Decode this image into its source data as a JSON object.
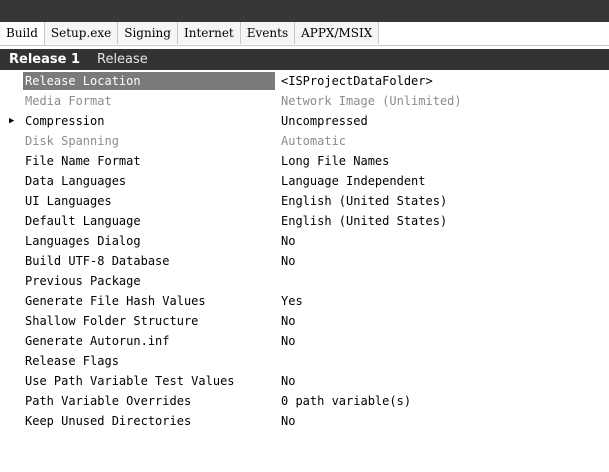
{
  "tabs": [
    {
      "label": "Build",
      "active": true
    },
    {
      "label": "Setup.exe",
      "active": false
    },
    {
      "label": "Signing",
      "active": false
    },
    {
      "label": "Internet",
      "active": false
    },
    {
      "label": "Events",
      "active": false
    },
    {
      "label": "APPX/MSIX",
      "active": false
    }
  ],
  "release": {
    "name": "Release 1",
    "type": "Release"
  },
  "properties": [
    {
      "name": "Release Location",
      "value": "<ISProjectDataFolder>",
      "selected": true,
      "disabled": false,
      "expandable": false
    },
    {
      "name": "Media Format",
      "value": "Network Image (Unlimited)",
      "selected": false,
      "disabled": true,
      "expandable": false
    },
    {
      "name": "Compression",
      "value": "Uncompressed",
      "selected": false,
      "disabled": false,
      "expandable": true
    },
    {
      "name": "Disk Spanning",
      "value": "Automatic",
      "selected": false,
      "disabled": true,
      "expandable": false
    },
    {
      "name": "File Name Format",
      "value": "Long File Names",
      "selected": false,
      "disabled": false,
      "expandable": false
    },
    {
      "name": "Data Languages",
      "value": "Language Independent",
      "selected": false,
      "disabled": false,
      "expandable": false
    },
    {
      "name": "UI Languages",
      "value": "English (United States)",
      "selected": false,
      "disabled": false,
      "expandable": false
    },
    {
      "name": "Default Language",
      "value": "English (United States)",
      "selected": false,
      "disabled": false,
      "expandable": false
    },
    {
      "name": "Languages Dialog",
      "value": "No",
      "selected": false,
      "disabled": false,
      "expandable": false
    },
    {
      "name": "Build UTF-8 Database",
      "value": "No",
      "selected": false,
      "disabled": false,
      "expandable": false
    },
    {
      "name": "Previous Package",
      "value": "",
      "selected": false,
      "disabled": false,
      "expandable": false
    },
    {
      "name": "Generate File Hash Values",
      "value": "Yes",
      "selected": false,
      "disabled": false,
      "expandable": false
    },
    {
      "name": "Shallow Folder Structure",
      "value": "No",
      "selected": false,
      "disabled": false,
      "expandable": false
    },
    {
      "name": "Generate Autorun.inf",
      "value": "No",
      "selected": false,
      "disabled": false,
      "expandable": false
    },
    {
      "name": "Release Flags",
      "value": "",
      "selected": false,
      "disabled": false,
      "expandable": false
    },
    {
      "name": "Use Path Variable Test Values",
      "value": "No",
      "selected": false,
      "disabled": false,
      "expandable": false
    },
    {
      "name": "Path Variable Overrides",
      "value": "0 path variable(s)",
      "selected": false,
      "disabled": false,
      "expandable": false
    },
    {
      "name": "Keep Unused Directories",
      "value": "No",
      "selected": false,
      "disabled": false,
      "expandable": false
    }
  ],
  "icons": {
    "expand": "triangle-right-icon",
    "expand_glyph": "▶"
  },
  "colors": {
    "selected_bg": "#7a7a7a",
    "header_bg": "#333333",
    "disabled_text": "#8c8c8c"
  }
}
